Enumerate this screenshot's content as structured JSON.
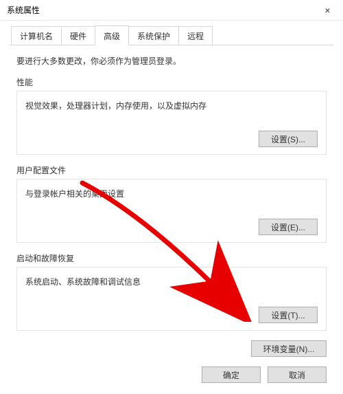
{
  "window": {
    "title": "系统属性",
    "close_icon": "×"
  },
  "tabs": {
    "t0": "计算机名",
    "t1": "硬件",
    "t2": "高级",
    "t3": "系统保护",
    "t4": "远程"
  },
  "advanced": {
    "intro": "要进行大多数更改，你必须作为管理员登录。",
    "perf": {
      "title": "性能",
      "desc": "视觉效果，处理器计划，内存使用，以及虚拟内存",
      "btn": "设置(S)..."
    },
    "profiles": {
      "title": "用户配置文件",
      "desc": "与登录帐户相关的桌面设置",
      "btn": "设置(E)..."
    },
    "startup": {
      "title": "启动和故障恢复",
      "desc": "系统启动、系统故障和调试信息",
      "btn": "设置(T)..."
    },
    "env_btn": "环境变量(N)..."
  },
  "footer": {
    "ok": "确定",
    "cancel": "取消"
  },
  "annotation": {
    "arrow_color": "#e60000"
  }
}
